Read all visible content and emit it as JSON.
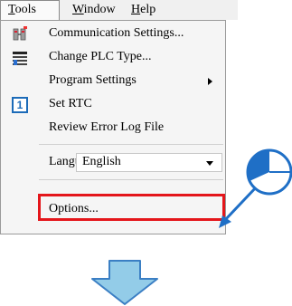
{
  "menubar": {
    "items": [
      {
        "label": "Tools",
        "underline": "T"
      },
      {
        "label": "Window",
        "underline": "W"
      },
      {
        "label": "Help",
        "underline": "H"
      }
    ]
  },
  "menu": {
    "communication_settings": "Communication Settings...",
    "change_plc_type": "Change PLC Type...",
    "program_settings": "Program Settings",
    "set_rtc": "Set RTC",
    "set_rtc_icon_text": "1",
    "review_error_log": "Review Error Log File",
    "language_label": "Language",
    "language_value": "English",
    "options": "Options..."
  },
  "icons": {
    "communication": "communication-icon",
    "change_plc": "plc-type-icon",
    "rtc": "calendar-icon",
    "pointer": "pie-cursor-icon",
    "next_step": "down-arrow-icon"
  },
  "colors": {
    "highlight_box": "#e4161b",
    "arrow_fill": "#93cce8",
    "arrow_stroke": "#3b7fc4",
    "pointer_blue": "#1f6fc6"
  }
}
